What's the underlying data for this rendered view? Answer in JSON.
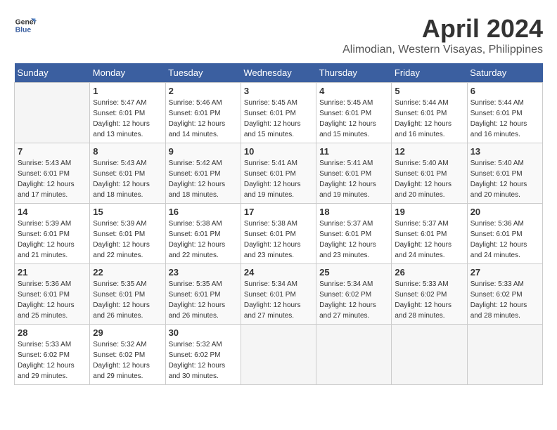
{
  "header": {
    "logo_line1": "General",
    "logo_line2": "Blue",
    "month": "April 2024",
    "location": "Alimodian, Western Visayas, Philippines"
  },
  "weekdays": [
    "Sunday",
    "Monday",
    "Tuesday",
    "Wednesday",
    "Thursday",
    "Friday",
    "Saturday"
  ],
  "weeks": [
    [
      {
        "day": "",
        "sunrise": "",
        "sunset": "",
        "daylight": ""
      },
      {
        "day": "1",
        "sunrise": "Sunrise: 5:47 AM",
        "sunset": "Sunset: 6:01 PM",
        "daylight": "Daylight: 12 hours and 13 minutes."
      },
      {
        "day": "2",
        "sunrise": "Sunrise: 5:46 AM",
        "sunset": "Sunset: 6:01 PM",
        "daylight": "Daylight: 12 hours and 14 minutes."
      },
      {
        "day": "3",
        "sunrise": "Sunrise: 5:45 AM",
        "sunset": "Sunset: 6:01 PM",
        "daylight": "Daylight: 12 hours and 15 minutes."
      },
      {
        "day": "4",
        "sunrise": "Sunrise: 5:45 AM",
        "sunset": "Sunset: 6:01 PM",
        "daylight": "Daylight: 12 hours and 15 minutes."
      },
      {
        "day": "5",
        "sunrise": "Sunrise: 5:44 AM",
        "sunset": "Sunset: 6:01 PM",
        "daylight": "Daylight: 12 hours and 16 minutes."
      },
      {
        "day": "6",
        "sunrise": "Sunrise: 5:44 AM",
        "sunset": "Sunset: 6:01 PM",
        "daylight": "Daylight: 12 hours and 16 minutes."
      }
    ],
    [
      {
        "day": "7",
        "sunrise": "Sunrise: 5:43 AM",
        "sunset": "Sunset: 6:01 PM",
        "daylight": "Daylight: 12 hours and 17 minutes."
      },
      {
        "day": "8",
        "sunrise": "Sunrise: 5:43 AM",
        "sunset": "Sunset: 6:01 PM",
        "daylight": "Daylight: 12 hours and 18 minutes."
      },
      {
        "day": "9",
        "sunrise": "Sunrise: 5:42 AM",
        "sunset": "Sunset: 6:01 PM",
        "daylight": "Daylight: 12 hours and 18 minutes."
      },
      {
        "day": "10",
        "sunrise": "Sunrise: 5:41 AM",
        "sunset": "Sunset: 6:01 PM",
        "daylight": "Daylight: 12 hours and 19 minutes."
      },
      {
        "day": "11",
        "sunrise": "Sunrise: 5:41 AM",
        "sunset": "Sunset: 6:01 PM",
        "daylight": "Daylight: 12 hours and 19 minutes."
      },
      {
        "day": "12",
        "sunrise": "Sunrise: 5:40 AM",
        "sunset": "Sunset: 6:01 PM",
        "daylight": "Daylight: 12 hours and 20 minutes."
      },
      {
        "day": "13",
        "sunrise": "Sunrise: 5:40 AM",
        "sunset": "Sunset: 6:01 PM",
        "daylight": "Daylight: 12 hours and 20 minutes."
      }
    ],
    [
      {
        "day": "14",
        "sunrise": "Sunrise: 5:39 AM",
        "sunset": "Sunset: 6:01 PM",
        "daylight": "Daylight: 12 hours and 21 minutes."
      },
      {
        "day": "15",
        "sunrise": "Sunrise: 5:39 AM",
        "sunset": "Sunset: 6:01 PM",
        "daylight": "Daylight: 12 hours and 22 minutes."
      },
      {
        "day": "16",
        "sunrise": "Sunrise: 5:38 AM",
        "sunset": "Sunset: 6:01 PM",
        "daylight": "Daylight: 12 hours and 22 minutes."
      },
      {
        "day": "17",
        "sunrise": "Sunrise: 5:38 AM",
        "sunset": "Sunset: 6:01 PM",
        "daylight": "Daylight: 12 hours and 23 minutes."
      },
      {
        "day": "18",
        "sunrise": "Sunrise: 5:37 AM",
        "sunset": "Sunset: 6:01 PM",
        "daylight": "Daylight: 12 hours and 23 minutes."
      },
      {
        "day": "19",
        "sunrise": "Sunrise: 5:37 AM",
        "sunset": "Sunset: 6:01 PM",
        "daylight": "Daylight: 12 hours and 24 minutes."
      },
      {
        "day": "20",
        "sunrise": "Sunrise: 5:36 AM",
        "sunset": "Sunset: 6:01 PM",
        "daylight": "Daylight: 12 hours and 24 minutes."
      }
    ],
    [
      {
        "day": "21",
        "sunrise": "Sunrise: 5:36 AM",
        "sunset": "Sunset: 6:01 PM",
        "daylight": "Daylight: 12 hours and 25 minutes."
      },
      {
        "day": "22",
        "sunrise": "Sunrise: 5:35 AM",
        "sunset": "Sunset: 6:01 PM",
        "daylight": "Daylight: 12 hours and 26 minutes."
      },
      {
        "day": "23",
        "sunrise": "Sunrise: 5:35 AM",
        "sunset": "Sunset: 6:01 PM",
        "daylight": "Daylight: 12 hours and 26 minutes."
      },
      {
        "day": "24",
        "sunrise": "Sunrise: 5:34 AM",
        "sunset": "Sunset: 6:01 PM",
        "daylight": "Daylight: 12 hours and 27 minutes."
      },
      {
        "day": "25",
        "sunrise": "Sunrise: 5:34 AM",
        "sunset": "Sunset: 6:02 PM",
        "daylight": "Daylight: 12 hours and 27 minutes."
      },
      {
        "day": "26",
        "sunrise": "Sunrise: 5:33 AM",
        "sunset": "Sunset: 6:02 PM",
        "daylight": "Daylight: 12 hours and 28 minutes."
      },
      {
        "day": "27",
        "sunrise": "Sunrise: 5:33 AM",
        "sunset": "Sunset: 6:02 PM",
        "daylight": "Daylight: 12 hours and 28 minutes."
      }
    ],
    [
      {
        "day": "28",
        "sunrise": "Sunrise: 5:33 AM",
        "sunset": "Sunset: 6:02 PM",
        "daylight": "Daylight: 12 hours and 29 minutes."
      },
      {
        "day": "29",
        "sunrise": "Sunrise: 5:32 AM",
        "sunset": "Sunset: 6:02 PM",
        "daylight": "Daylight: 12 hours and 29 minutes."
      },
      {
        "day": "30",
        "sunrise": "Sunrise: 5:32 AM",
        "sunset": "Sunset: 6:02 PM",
        "daylight": "Daylight: 12 hours and 30 minutes."
      },
      {
        "day": "",
        "sunrise": "",
        "sunset": "",
        "daylight": ""
      },
      {
        "day": "",
        "sunrise": "",
        "sunset": "",
        "daylight": ""
      },
      {
        "day": "",
        "sunrise": "",
        "sunset": "",
        "daylight": ""
      },
      {
        "day": "",
        "sunrise": "",
        "sunset": "",
        "daylight": ""
      }
    ]
  ]
}
